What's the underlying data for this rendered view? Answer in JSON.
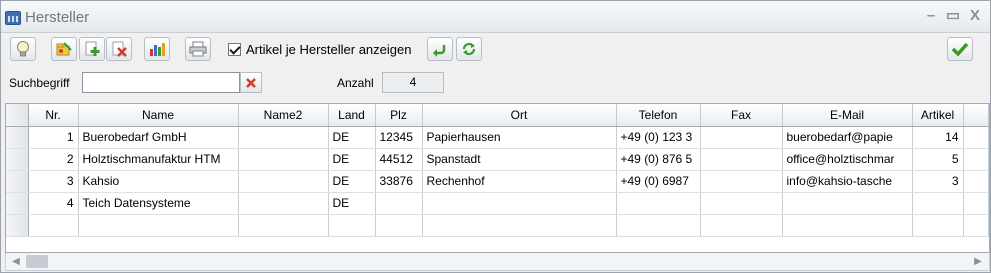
{
  "window": {
    "title": "Hersteller",
    "controls": {
      "minimize": "–",
      "maximize": "▭",
      "close": "X"
    }
  },
  "toolbar": {
    "buttons": [
      {
        "name": "lightbulb-icon"
      },
      {
        "name": "folder-edit-icon"
      },
      {
        "name": "add-icon"
      },
      {
        "name": "delete-icon"
      },
      {
        "name": "chart-icon"
      },
      {
        "name": "print-icon"
      },
      {
        "name": "undo-icon"
      },
      {
        "name": "refresh-icon"
      },
      {
        "name": "confirm-icon"
      }
    ],
    "checkbox_label": "Artikel je Hersteller anzeigen",
    "checkbox_checked": true
  },
  "search": {
    "label": "Suchbegriff",
    "value": "",
    "count_label": "Anzahl",
    "count_value": "4"
  },
  "grid": {
    "columns": [
      "Nr.",
      "Name",
      "Name2",
      "Land",
      "Plz",
      "Ort",
      "Telefon",
      "Fax",
      "E-Mail",
      "Artikel"
    ],
    "rows": [
      [
        "1",
        "Buerobedarf GmbH",
        "",
        "DE",
        "12345",
        "Papierhausen",
        "+49 (0) 123 3",
        "",
        "buerobedarf@papie",
        "14"
      ],
      [
        "2",
        "Holztischmanufaktur HTM",
        "",
        "DE",
        "44512",
        "Spanstadt",
        "+49 (0) 876 5",
        "",
        "office@holztischmar",
        "5"
      ],
      [
        "3",
        "Kahsio",
        "",
        "DE",
        "33876",
        "Rechenhof",
        "+49 (0) 6987",
        "",
        "info@kahsio-tasche",
        "3"
      ],
      [
        "4",
        "Teich Datensysteme",
        "",
        "DE",
        "",
        "",
        "",
        "",
        "",
        ""
      ],
      [
        "",
        "",
        "",
        "",
        "",
        "",
        "",
        "",
        "",
        ""
      ]
    ]
  },
  "colors": {
    "accent_green": "#3a9a2a",
    "delete_red": "#d23a2a",
    "title_grey": "#6e7782"
  }
}
